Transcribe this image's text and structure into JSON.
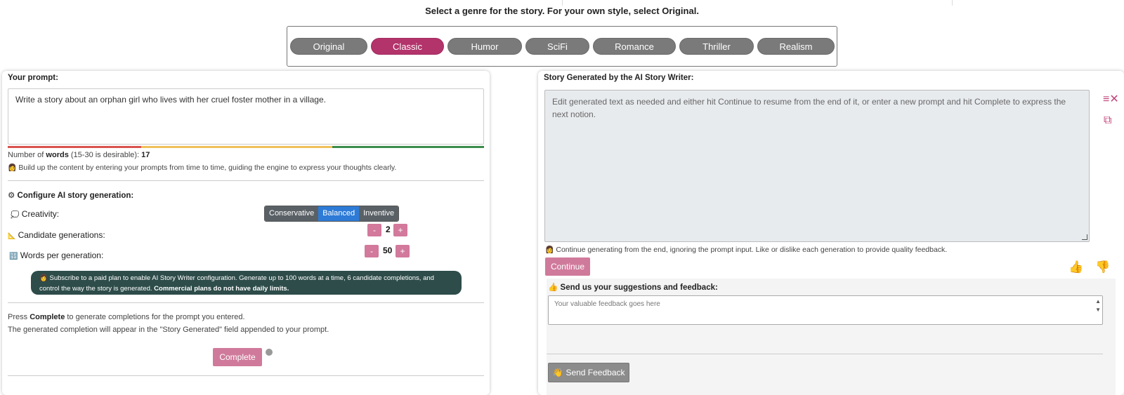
{
  "header": {
    "instruction": "Select a genre for the story. For your own style, select Original."
  },
  "genres": [
    {
      "label": "Original",
      "active": false
    },
    {
      "label": "Classic",
      "active": true
    },
    {
      "label": "Humor",
      "active": false
    },
    {
      "label": "SciFi",
      "active": false
    },
    {
      "label": "Romance",
      "active": false
    },
    {
      "label": "Thriller",
      "active": false
    },
    {
      "label": "Realism",
      "active": false
    }
  ],
  "prompt": {
    "label": "Your prompt:",
    "value": "Write a story about an orphan girl who lives with her cruel foster mother in a village.",
    "word_count_prefix": "Number of ",
    "word_count_word": "words",
    "word_count_suffix": " (15-30 is desirable): ",
    "word_count": "17",
    "hint_icon": "👩",
    "hint": "Build up the content by entering your prompts from time to time, guiding the engine to express your thoughts clearly."
  },
  "config": {
    "title_icon": "⚙",
    "title": "Configure AI story generation:",
    "creativity_icon": "💭",
    "creativity_label": "Creativity:",
    "creativity_options": [
      "Conservative",
      "Balanced",
      "Inventive"
    ],
    "creativity_selected": "Balanced",
    "candidates_icon": "📐",
    "candidates_label": "Candidate generations:",
    "candidates_value": "2",
    "words_icon": "🔢",
    "words_label": "Words per generation:",
    "words_value": "50",
    "minus": "-",
    "plus": "+",
    "notice_icon": "👩",
    "notice_text": "Subscribe to a paid plan to enable AI Story Writer configuration. Generate up to 100 words at a time, 6 candidate completions, and control the way the story is generated. ",
    "notice_bold": "Commercial plans do not have daily limits."
  },
  "complete": {
    "press": "Press ",
    "complete_word": "Complete",
    "rest": " to generate completions for the prompt you entered.",
    "line2": "The generated completion will appear in the \"Story Generated\" field appended to your prompt.",
    "button": "Complete"
  },
  "story": {
    "label": "Story Generated by the AI Story Writer:",
    "placeholder": "Edit generated text as needed and either hit Continue to resume from the end of it, or enter a new prompt and hit Complete to express the next notion.",
    "continue_hint_icon": "👩",
    "continue_hint": "Continue generating from the end, ignoring the prompt input. Like or dislike each generation to provide quality feedback.",
    "continue_button": "Continue"
  },
  "feedback": {
    "title_icon": "👍",
    "title": "Send us your suggestions and feedback:",
    "placeholder": "Your valuable feedback goes here",
    "send_icon": "👋",
    "send_button": "Send Feedback"
  },
  "colors": {
    "accent": "#b3336b",
    "button_pink": "#d07a9b",
    "genre_gray": "#7a7a7a",
    "notice_bg": "#2d4c4a",
    "selected_blue": "#2d7bd6"
  }
}
